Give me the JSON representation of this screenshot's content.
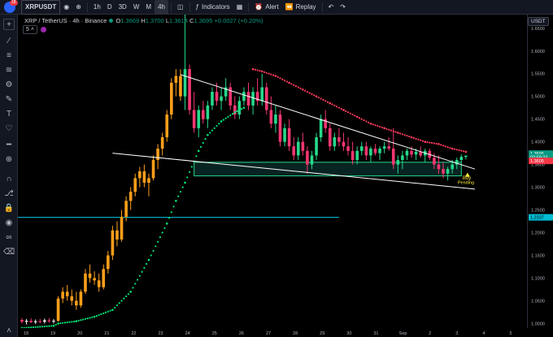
{
  "toolbar": {
    "avatar_badge": "18",
    "symbol": "XRPUSDT",
    "timeframes": [
      "1h",
      "D",
      "3D",
      "W",
      "M",
      "4h"
    ],
    "active_timeframe": "4h",
    "indicators_label": "Indicators",
    "alert_label": "Alert",
    "replay_label": "Replay"
  },
  "legend": {
    "title": "XRP / TetherUS · 4h · Binance",
    "o_label": "O",
    "o": "1.3669",
    "h_label": "H",
    "h": "1.3700",
    "l_label": "L",
    "l": "1.3614",
    "c_label": "C",
    "c": "1.3695",
    "change": "+0.0027 (+0.20%)"
  },
  "indicator_row": {
    "eye_value": "5"
  },
  "price_scale": {
    "currency": "USDT",
    "ticks": [
      "1.6500",
      "1.6000",
      "1.5500",
      "1.5000",
      "1.4500",
      "1.4000",
      "1.3500",
      "1.3000",
      "1.2500",
      "1.2000",
      "1.1500",
      "1.1000",
      "1.0500",
      "1.0000"
    ],
    "last_price_label": "1.3695",
    "countdown_label": "02:59:23",
    "support_label": "1.3605",
    "hline_label": "1.2337"
  },
  "time_axis": {
    "labels": [
      "18",
      "19",
      "20",
      "21",
      "22",
      "23",
      "24",
      "25",
      "26",
      "27",
      "28",
      "29",
      "30",
      "31",
      "Sep",
      "2",
      "3",
      "4",
      "5"
    ]
  },
  "annotations": {
    "buy_label": "Buy",
    "pending_label": "Pending"
  },
  "colors": {
    "background": "#000000",
    "up_candle": "#26d98b",
    "down_candle": "#f23670",
    "early_candle": "#ff9f1a",
    "psar_up": "#00e676",
    "psar_down": "#ff3b5c",
    "hline": "#00bcd4",
    "zone": "#26a69a",
    "trendline": "#ffffff"
  },
  "chart_data": {
    "type": "candlestick",
    "title": "XRP / TetherUS · 4h · Binance",
    "x_labels": [
      "18",
      "19",
      "20",
      "21",
      "22",
      "23",
      "24",
      "25",
      "26",
      "27",
      "28",
      "29",
      "30",
      "31",
      "Sep",
      "2",
      "3",
      "4",
      "5"
    ],
    "ylim": [
      0.99,
      1.68
    ],
    "candles": [
      [
        1.008,
        1.012,
        1.0,
        1.004
      ],
      [
        1.004,
        1.01,
        0.998,
        1.006
      ],
      [
        1.006,
        1.012,
        1.001,
        1.003
      ],
      [
        1.003,
        1.009,
        0.999,
        1.005
      ],
      [
        1.005,
        1.01,
        1.001,
        1.004
      ],
      [
        1.004,
        1.011,
        1.0,
        1.007
      ],
      [
        1.007,
        1.012,
        1.002,
        1.005
      ],
      [
        1.005,
        1.01,
        1.0,
        1.006
      ],
      [
        1.006,
        1.06,
        1.004,
        1.055
      ],
      [
        1.055,
        1.08,
        1.045,
        1.07
      ],
      [
        1.07,
        1.085,
        1.05,
        1.06
      ],
      [
        1.06,
        1.075,
        1.04,
        1.05
      ],
      [
        1.05,
        1.07,
        1.03,
        1.04
      ],
      [
        1.04,
        1.075,
        1.035,
        1.07
      ],
      [
        1.07,
        1.12,
        1.065,
        1.11
      ],
      [
        1.11,
        1.13,
        1.09,
        1.1
      ],
      [
        1.1,
        1.115,
        1.085,
        1.095
      ],
      [
        1.095,
        1.11,
        1.07,
        1.08
      ],
      [
        1.08,
        1.13,
        1.075,
        1.12
      ],
      [
        1.12,
        1.16,
        1.11,
        1.15
      ],
      [
        1.15,
        1.215,
        1.14,
        1.205
      ],
      [
        1.205,
        1.225,
        1.17,
        1.185
      ],
      [
        1.185,
        1.25,
        1.18,
        1.235
      ],
      [
        1.235,
        1.28,
        1.225,
        1.27
      ],
      [
        1.27,
        1.3,
        1.25,
        1.29
      ],
      [
        1.29,
        1.33,
        1.28,
        1.32
      ],
      [
        1.32,
        1.345,
        1.3,
        1.335
      ],
      [
        1.335,
        1.35,
        1.3,
        1.31
      ],
      [
        1.31,
        1.33,
        1.28,
        1.32
      ],
      [
        1.32,
        1.37,
        1.315,
        1.36
      ],
      [
        1.36,
        1.395,
        1.34,
        1.385
      ],
      [
        1.385,
        1.42,
        1.37,
        1.41
      ],
      [
        1.41,
        1.47,
        1.4,
        1.46
      ],
      [
        1.46,
        1.54,
        1.45,
        1.53
      ],
      [
        1.53,
        1.56,
        1.5,
        1.545
      ],
      [
        1.545,
        1.56,
        1.49,
        1.5
      ],
      [
        1.5,
        1.69,
        1.47,
        1.56
      ],
      [
        1.56,
        1.57,
        1.46,
        1.47
      ],
      [
        1.47,
        1.51,
        1.42,
        1.43
      ],
      [
        1.43,
        1.48,
        1.41,
        1.47
      ],
      [
        1.47,
        1.49,
        1.44,
        1.45
      ],
      [
        1.45,
        1.49,
        1.43,
        1.48
      ],
      [
        1.48,
        1.52,
        1.47,
        1.51
      ],
      [
        1.51,
        1.53,
        1.48,
        1.49
      ],
      [
        1.49,
        1.52,
        1.47,
        1.5
      ],
      [
        1.5,
        1.54,
        1.49,
        1.52
      ],
      [
        1.52,
        1.53,
        1.47,
        1.48
      ],
      [
        1.48,
        1.5,
        1.45,
        1.46
      ],
      [
        1.46,
        1.5,
        1.45,
        1.49
      ],
      [
        1.49,
        1.52,
        1.48,
        1.51
      ],
      [
        1.51,
        1.53,
        1.47,
        1.48
      ],
      [
        1.48,
        1.52,
        1.46,
        1.51
      ],
      [
        1.51,
        1.54,
        1.48,
        1.49
      ],
      [
        1.49,
        1.55,
        1.48,
        1.52
      ],
      [
        1.52,
        1.53,
        1.46,
        1.47
      ],
      [
        1.47,
        1.5,
        1.43,
        1.44
      ],
      [
        1.44,
        1.48,
        1.42,
        1.46
      ],
      [
        1.46,
        1.47,
        1.39,
        1.4
      ],
      [
        1.4,
        1.44,
        1.39,
        1.43
      ],
      [
        1.43,
        1.45,
        1.38,
        1.39
      ],
      [
        1.39,
        1.41,
        1.36,
        1.37
      ],
      [
        1.37,
        1.41,
        1.36,
        1.4
      ],
      [
        1.4,
        1.42,
        1.37,
        1.38
      ],
      [
        1.38,
        1.39,
        1.33,
        1.35
      ],
      [
        1.35,
        1.38,
        1.34,
        1.37
      ],
      [
        1.37,
        1.42,
        1.36,
        1.41
      ],
      [
        1.41,
        1.46,
        1.4,
        1.45
      ],
      [
        1.45,
        1.47,
        1.42,
        1.43
      ],
      [
        1.43,
        1.44,
        1.38,
        1.39
      ],
      [
        1.39,
        1.42,
        1.38,
        1.41
      ],
      [
        1.41,
        1.43,
        1.39,
        1.4
      ],
      [
        1.4,
        1.42,
        1.38,
        1.39
      ],
      [
        1.39,
        1.41,
        1.37,
        1.38
      ],
      [
        1.38,
        1.4,
        1.35,
        1.36
      ],
      [
        1.36,
        1.39,
        1.35,
        1.38
      ],
      [
        1.38,
        1.4,
        1.37,
        1.39
      ],
      [
        1.39,
        1.4,
        1.36,
        1.37
      ],
      [
        1.37,
        1.39,
        1.355,
        1.385
      ],
      [
        1.385,
        1.395,
        1.37,
        1.375
      ],
      [
        1.375,
        1.39,
        1.36,
        1.385
      ],
      [
        1.385,
        1.4,
        1.375,
        1.39
      ],
      [
        1.39,
        1.41,
        1.38,
        1.385
      ],
      [
        1.385,
        1.43,
        1.34,
        1.35
      ],
      [
        1.35,
        1.37,
        1.33,
        1.36
      ],
      [
        1.36,
        1.38,
        1.34,
        1.37
      ],
      [
        1.37,
        1.385,
        1.36,
        1.38
      ],
      [
        1.38,
        1.39,
        1.365,
        1.372
      ],
      [
        1.372,
        1.385,
        1.36,
        1.378
      ],
      [
        1.378,
        1.39,
        1.365,
        1.37
      ],
      [
        1.37,
        1.385,
        1.355,
        1.38
      ],
      [
        1.38,
        1.385,
        1.36,
        1.365
      ],
      [
        1.365,
        1.375,
        1.34,
        1.35
      ],
      [
        1.35,
        1.37,
        1.33,
        1.34
      ],
      [
        1.34,
        1.355,
        1.32,
        1.33
      ],
      [
        1.33,
        1.345,
        1.315,
        1.34
      ],
      [
        1.34,
        1.36,
        1.33,
        1.35
      ],
      [
        1.35,
        1.365,
        1.34,
        1.36
      ],
      [
        1.36,
        1.372,
        1.355,
        1.3669
      ],
      [
        1.3669,
        1.37,
        1.3614,
        1.3695
      ]
    ],
    "psar": {
      "up": [
        [
          0,
          0.99
        ],
        [
          7,
          0.995
        ],
        [
          8,
          1.0
        ],
        [
          12,
          1.005
        ],
        [
          16,
          1.015
        ],
        [
          20,
          1.03
        ],
        [
          24,
          1.07
        ],
        [
          28,
          1.14
        ],
        [
          32,
          1.22
        ],
        [
          34,
          1.27
        ],
        [
          36,
          1.31
        ],
        [
          39,
          1.38
        ],
        [
          41,
          1.415
        ],
        [
          44,
          1.445
        ],
        [
          47,
          1.465
        ],
        [
          49,
          1.475
        ]
      ],
      "down": [
        [
          51,
          1.56
        ],
        [
          53,
          1.555
        ],
        [
          56,
          1.545
        ],
        [
          59,
          1.53
        ],
        [
          62,
          1.515
        ],
        [
          65,
          1.5
        ],
        [
          68,
          1.485
        ],
        [
          71,
          1.47
        ],
        [
          74,
          1.455
        ],
        [
          77,
          1.44
        ],
        [
          80,
          1.43
        ],
        [
          83,
          1.42
        ],
        [
          86,
          1.41
        ],
        [
          89,
          1.4
        ],
        [
          92,
          1.395
        ],
        [
          95,
          1.385
        ],
        [
          98,
          1.378
        ]
      ]
    },
    "drawings": {
      "upper_trendline": [
        [
          35,
          1.548
        ],
        [
          100,
          1.34
        ]
      ],
      "lower_trendline": [
        [
          20,
          1.375
        ],
        [
          100,
          1.296
        ]
      ],
      "zone": {
        "x": [
          38,
          97
        ],
        "y": [
          1.325,
          1.355
        ]
      },
      "hline": {
        "x": [
          -1,
          70
        ],
        "y": 1.2337
      }
    }
  }
}
